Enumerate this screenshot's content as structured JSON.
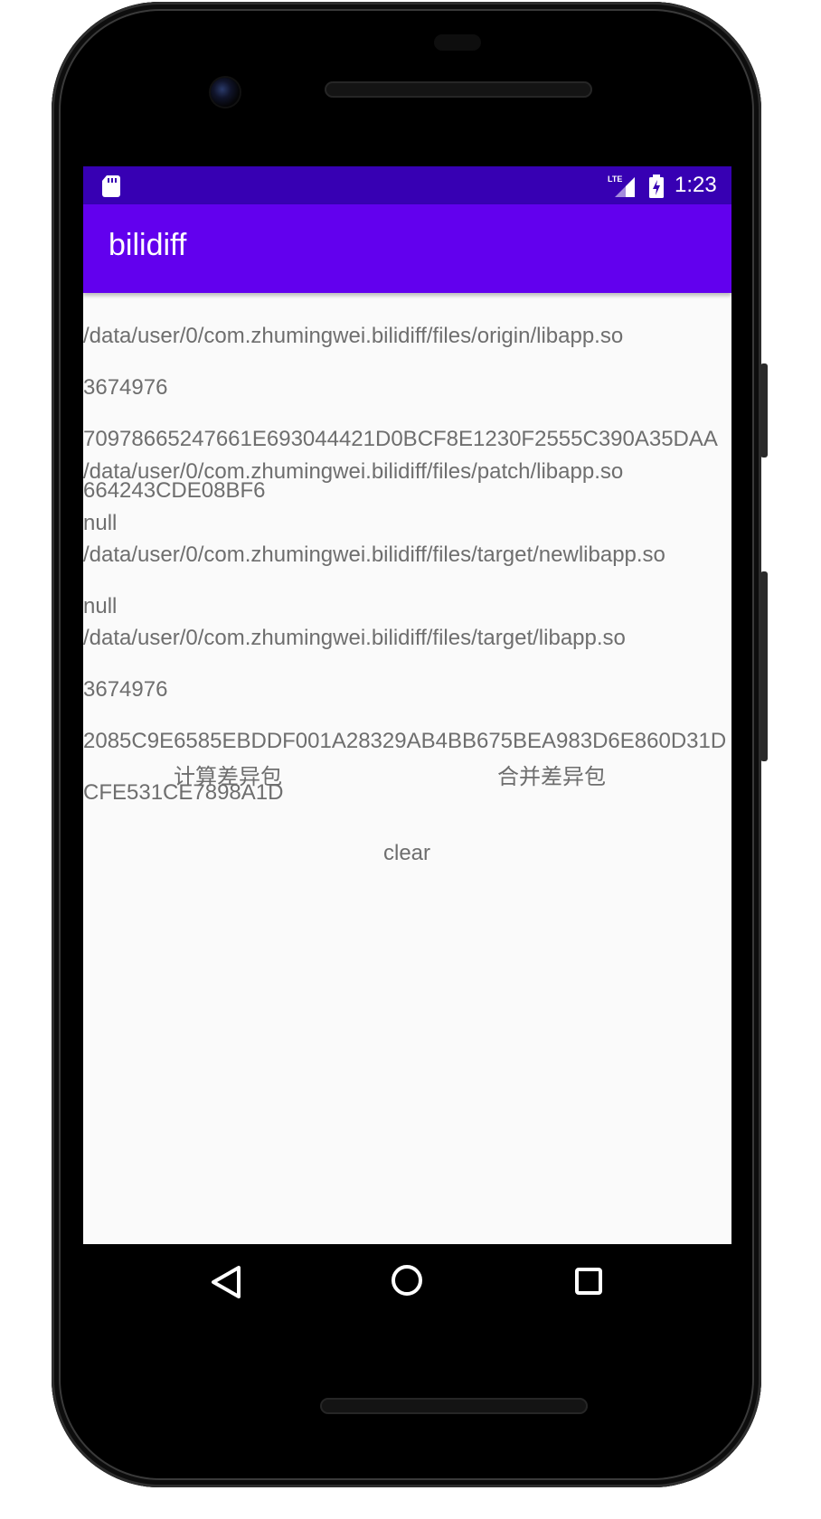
{
  "status_bar": {
    "time": "1:23",
    "icons": [
      "sd-card-icon",
      "lte-signal-icon",
      "battery-charging-icon"
    ]
  },
  "app_bar": {
    "title": "bilidiff",
    "color": "#6200ee"
  },
  "colors": {
    "status_bar": "#3700b3",
    "primary": "#6200ee",
    "background": "#fafafa",
    "text": "#6e6e6e"
  },
  "files": [
    {
      "path": "/data/user/0/com.zhumingwei.bilidiff/files/origin/libapp.so",
      "size": "3674976",
      "hash_line1": "70978665247661E693044421D0BCF8E1230F2555C390A35DAA",
      "hash_line2": "664243CDE08BF6"
    },
    {
      "path": "/data/user/0/com.zhumingwei.bilidiff/files/patch/libapp.so",
      "size": "null"
    },
    {
      "path": "/data/user/0/com.zhumingwei.bilidiff/files/target/newlibapp.so",
      "size": "null"
    },
    {
      "path": "/data/user/0/com.zhumingwei.bilidiff/files/target/libapp.so",
      "size": "3674976",
      "hash_line1": "2085C9E6585EBDDF001A28329AB4BB675BEA983D6E860D31D",
      "hash_line2": "CFE531CE7898A1D"
    }
  ],
  "buttons": {
    "compute_diff": "计算差异包",
    "merge_diff": "合并差异包",
    "clear": "clear"
  },
  "nav_bar": {
    "icons": [
      "back-icon",
      "home-icon",
      "recents-icon"
    ]
  }
}
